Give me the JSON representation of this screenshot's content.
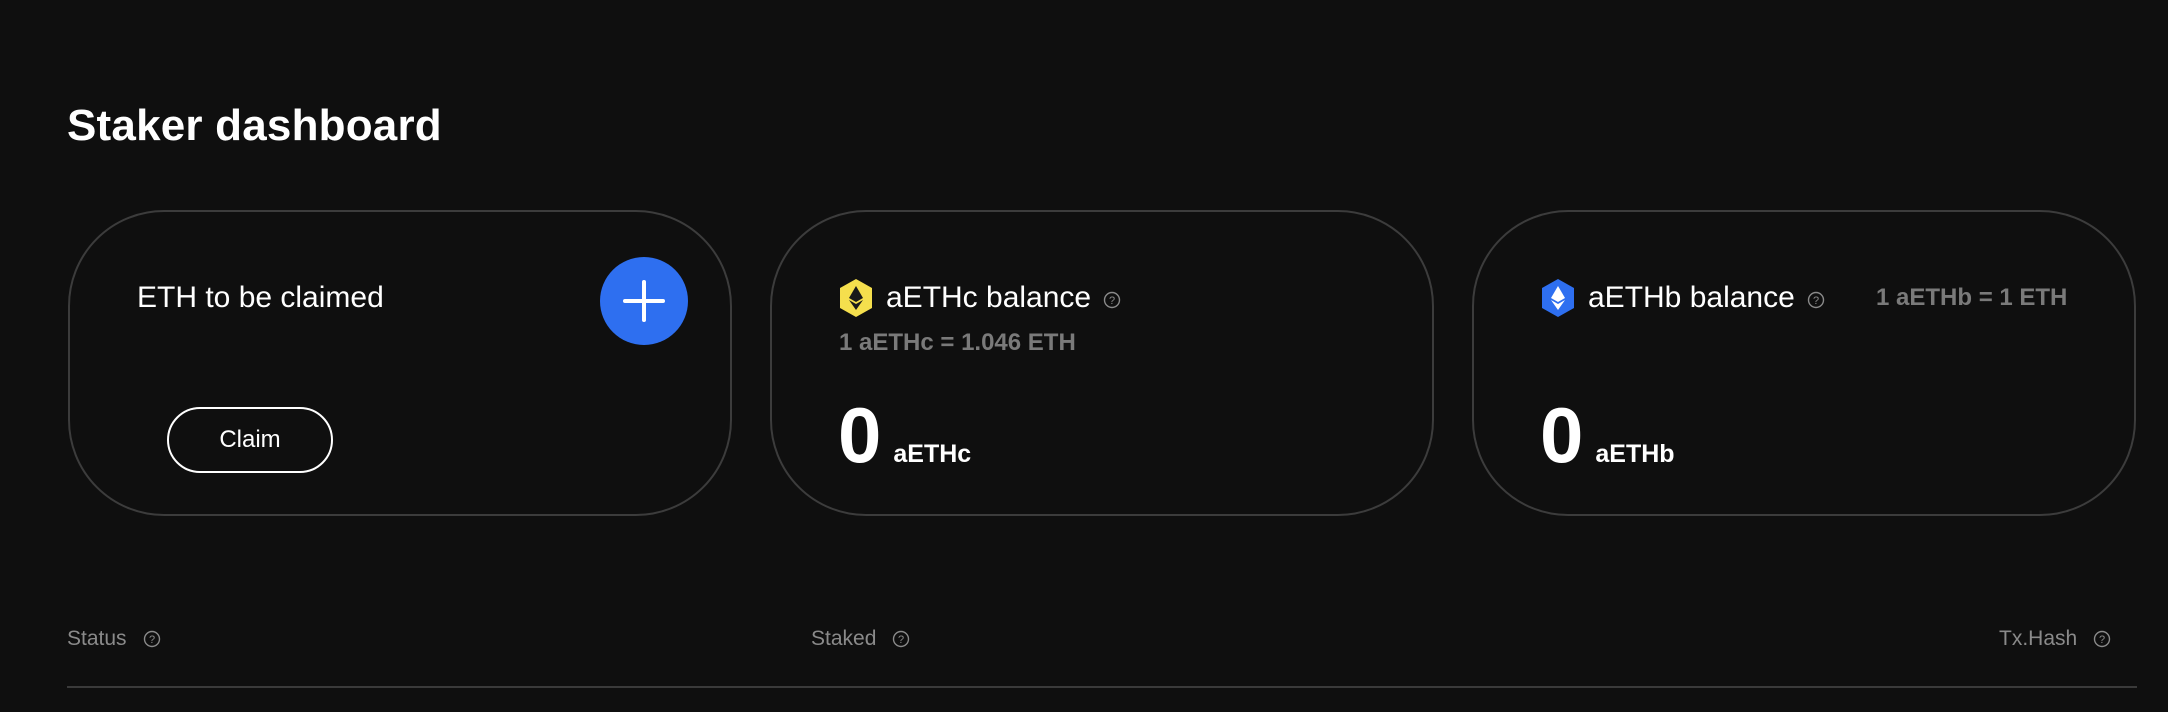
{
  "page": {
    "title": "Staker dashboard"
  },
  "claim_card": {
    "title": "ETH to be claimed",
    "add_icon": "plus-icon",
    "claim_label": "Claim"
  },
  "aethc_card": {
    "icon": "eth-token-yellow-hexagon-icon",
    "title": "aETHc balance",
    "help_icon": "question-circle-icon",
    "rate": "1 aETHc = 1.046 ETH",
    "balance": "0",
    "unit": "aETHc"
  },
  "aethb_card": {
    "icon": "eth-token-blue-hexagon-icon",
    "title": "aETHb balance",
    "help_icon": "question-circle-icon",
    "rate": "1 aETHb = 1 ETH",
    "balance": "0",
    "unit": "aETHb"
  },
  "table": {
    "columns": [
      {
        "label": "Status",
        "help_icon": "question-circle-icon"
      },
      {
        "label": "Staked",
        "help_icon": "question-circle-icon"
      },
      {
        "label": "Tx.Hash",
        "help_icon": "question-circle-icon"
      }
    ]
  },
  "colors": {
    "background": "#0f0f0f",
    "accent_blue": "#2e6ff0",
    "token_yellow": "#f5df4d",
    "muted_text": "#7a7a7a",
    "card_border": "#3c3c3c"
  }
}
